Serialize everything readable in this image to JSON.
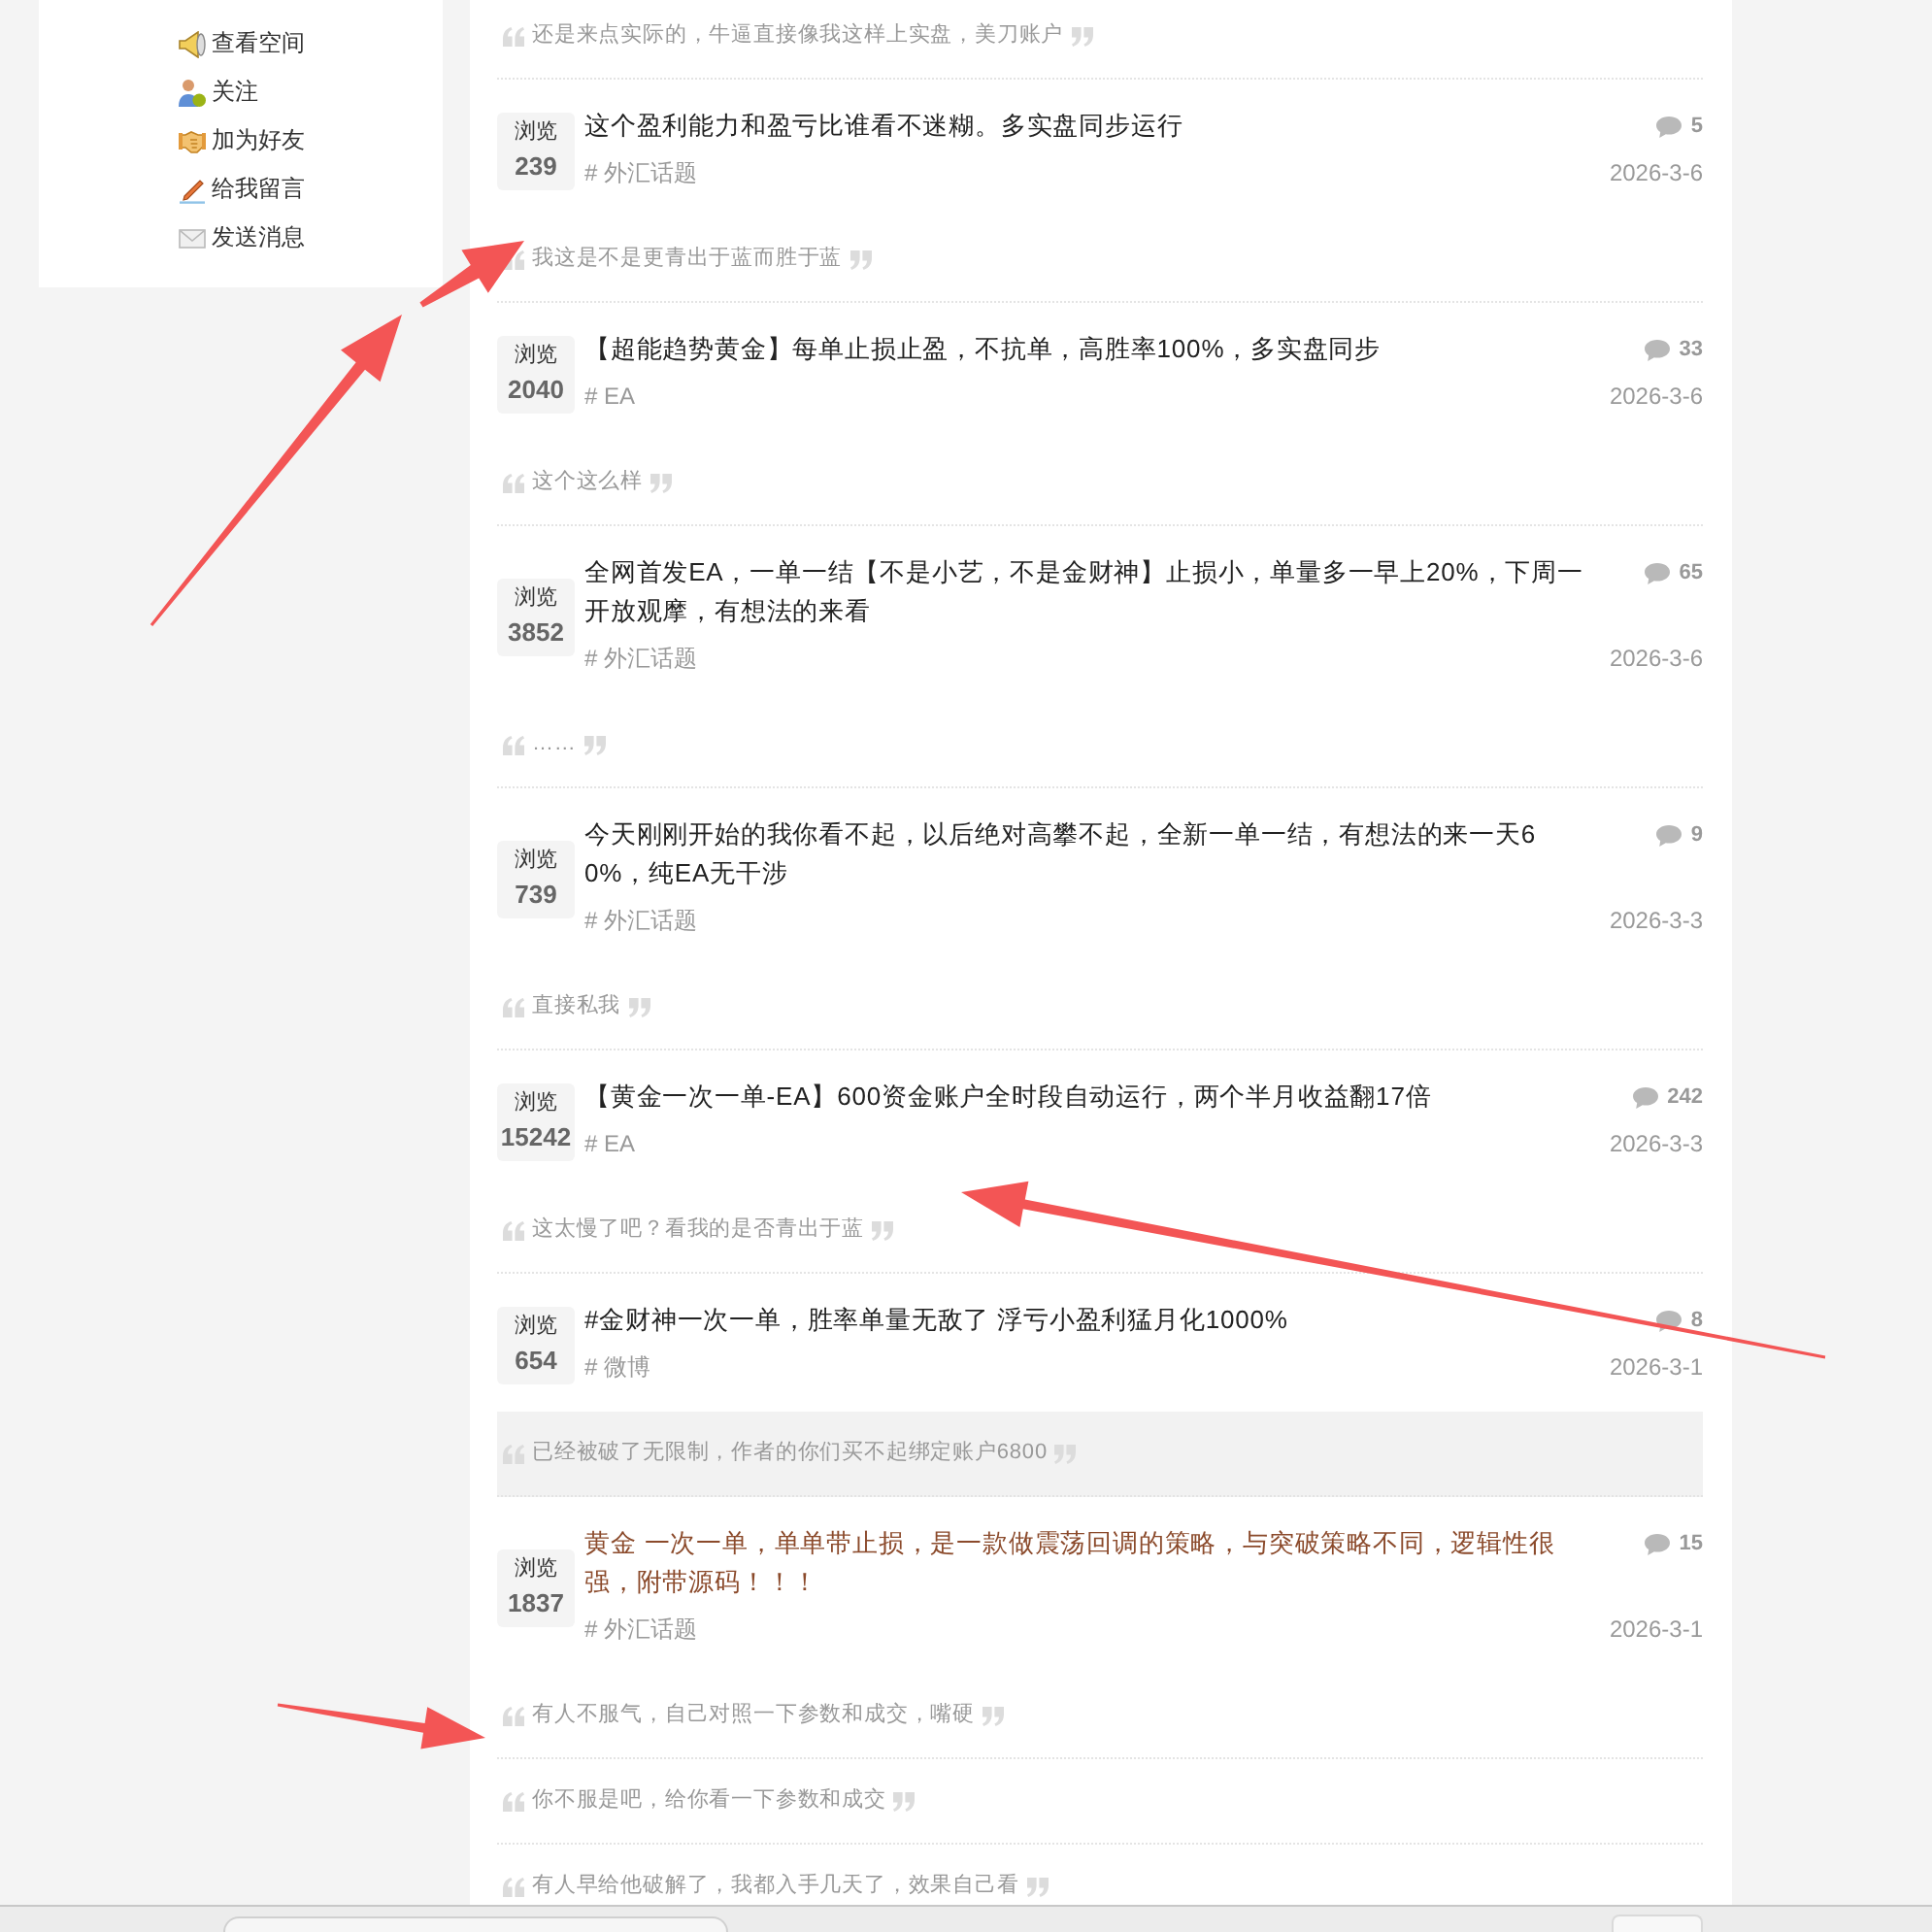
{
  "sidebar": {
    "items": [
      {
        "label": "查看空间"
      },
      {
        "label": "关注"
      },
      {
        "label": "加为好友"
      },
      {
        "label": "给我留言"
      },
      {
        "label": "发送消息"
      }
    ]
  },
  "feed": [
    {
      "kind": "quote",
      "text": "还是来点实际的，牛逼直接像我这样上实盘，美刀账户",
      "highlighted": false
    },
    {
      "kind": "topic",
      "views_label": "浏览",
      "views": "239",
      "title": "这个盈利能力和盈亏比谁看不迷糊。多实盘同步运行",
      "tag": "# 外汇话题",
      "comments": "5",
      "date": "2026-3-6",
      "highlighted": false
    },
    {
      "kind": "quote",
      "text": "我这是不是更青出于蓝而胜于蓝",
      "highlighted": false
    },
    {
      "kind": "topic",
      "views_label": "浏览",
      "views": "2040",
      "title": "【超能趋势黄金】每单止损止盈，不抗单，高胜率100%，多实盘同步",
      "tag": "# EA",
      "comments": "33",
      "date": "2026-3-6",
      "highlighted": false
    },
    {
      "kind": "quote",
      "text": "这个这么样",
      "highlighted": false
    },
    {
      "kind": "topic",
      "views_label": "浏览",
      "views": "3852",
      "title": "全网首发EA，一单一结【不是小艺，不是金财神】止损小，单量多一早上20%，下周一开放观摩，有想法的来看",
      "tag": "# 外汇话题",
      "comments": "65",
      "date": "2026-3-6",
      "highlighted": false
    },
    {
      "kind": "quote",
      "text": "……",
      "highlighted": false
    },
    {
      "kind": "topic",
      "views_label": "浏览",
      "views": "739",
      "title": "今天刚刚开始的我你看不起，以后绝对高攀不起，全新一单一结，有想法的来一天60%，纯EA无干涉",
      "tag": "# 外汇话题",
      "comments": "9",
      "date": "2026-3-3",
      "highlighted": false
    },
    {
      "kind": "quote",
      "text": "直接私我",
      "highlighted": false
    },
    {
      "kind": "topic",
      "views_label": "浏览",
      "views": "15242",
      "title": "【黄金一次一单-EA】600资金账户全时段自动运行，两个半月收益翻17倍",
      "tag": "# EA",
      "comments": "242",
      "date": "2026-3-3",
      "highlighted": false
    },
    {
      "kind": "quote",
      "text": "这太慢了吧？看我的是否青出于蓝",
      "highlighted": false
    },
    {
      "kind": "topic",
      "views_label": "浏览",
      "views": "654",
      "title": "#金财神一次一单，胜率单量无敌了 浮亏小盈利猛月化1000%",
      "tag": "# 微博",
      "comments": "8",
      "date": "2026-3-1",
      "highlighted": false
    },
    {
      "kind": "quote",
      "text": "已经被破了无限制，作者的你们买不起绑定账户6800",
      "highlighted": true
    },
    {
      "kind": "topic",
      "views_label": "浏览",
      "views": "1837",
      "title": "黄金 一次一单，单单带止损，是一款做震荡回调的策略，与突破策略不同，逻辑性很强，附带源码！！！",
      "tag": "# 外汇话题",
      "comments": "15",
      "date": "2026-3-1",
      "highlighted": true
    },
    {
      "kind": "quote",
      "text": "有人不服气，自己对照一下参数和成交，嘴硬",
      "highlighted": false
    },
    {
      "kind": "quote",
      "text": "你不服是吧，给你看一下参数和成交",
      "highlighted": false
    },
    {
      "kind": "quote",
      "text": "有人早给他破解了，我都入手几天了，效果自己看",
      "highlighted": false
    }
  ],
  "annotations": [
    {
      "kind": "arrow"
    },
    {
      "kind": "arrow"
    },
    {
      "kind": "arrow"
    },
    {
      "kind": "arrow"
    }
  ]
}
